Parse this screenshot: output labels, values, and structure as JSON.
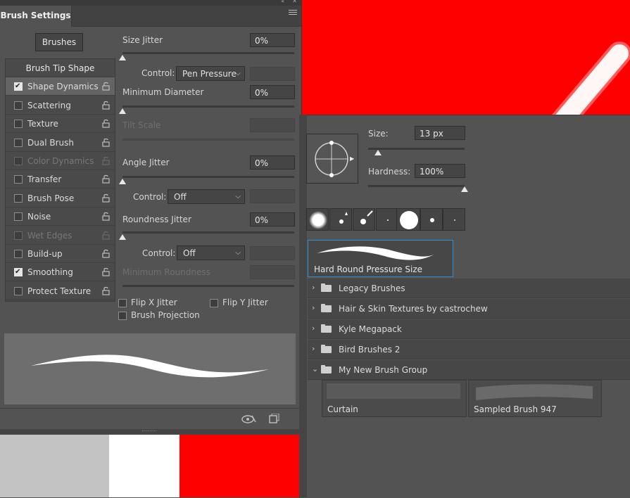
{
  "brush_settings": {
    "tab_title": "Brush Settings",
    "brushes_button": "Brushes",
    "options": [
      {
        "label": "Brush Tip Shape",
        "type": "header"
      },
      {
        "label": "Shape Dynamics",
        "checked": true,
        "selected": true
      },
      {
        "label": "Scattering",
        "checked": false
      },
      {
        "label": "Texture",
        "checked": false
      },
      {
        "label": "Dual Brush",
        "checked": false
      },
      {
        "label": "Color Dynamics",
        "checked": false,
        "disabled": true
      },
      {
        "label": "Transfer",
        "checked": false
      },
      {
        "label": "Brush Pose",
        "checked": false
      },
      {
        "label": "Noise",
        "checked": false
      },
      {
        "label": "Wet Edges",
        "checked": false,
        "disabled": true
      },
      {
        "label": "Build-up",
        "checked": false
      },
      {
        "label": "Smoothing",
        "checked": true
      },
      {
        "label": "Protect Texture",
        "checked": false
      }
    ],
    "size_jitter": {
      "label": "Size Jitter",
      "value": "0%",
      "level": 0
    },
    "size_control": {
      "label": "Control:",
      "value": "Pen Pressure"
    },
    "min_diameter": {
      "label": "Minimum Diameter",
      "value": "0%",
      "level": 0
    },
    "tilt_scale": {
      "label": "Tilt Scale"
    },
    "angle_jitter": {
      "label": "Angle Jitter",
      "value": "0%",
      "level": 0
    },
    "angle_control": {
      "label": "Control:",
      "value": "Off"
    },
    "roundness_jitter": {
      "label": "Roundness Jitter",
      "value": "0%",
      "level": 0
    },
    "roundness_control": {
      "label": "Control:",
      "value": "Off"
    },
    "min_roundness": {
      "label": "Minimum Roundness"
    },
    "flip_x": {
      "label": "Flip X Jitter",
      "checked": false
    },
    "flip_y": {
      "label": "Flip Y Jitter",
      "checked": false
    },
    "brush_projection": {
      "label": "Brush Projection",
      "checked": false
    }
  },
  "brush_picker": {
    "size_label": "Size:",
    "size_value": "13 px",
    "size_level": 0.05,
    "hardness_label": "Hardness:",
    "hardness_value": "100%",
    "hardness_level": 1.0,
    "selected_brush": "Hard Round Pressure Size",
    "groups": [
      {
        "name": "Legacy Brushes",
        "expanded": false
      },
      {
        "name": "Hair & Skin Textures by castrochew",
        "expanded": false
      },
      {
        "name": "Kyle Megapack",
        "expanded": false
      },
      {
        "name": "Bird Brushes 2",
        "expanded": false
      },
      {
        "name": "My New Brush Group",
        "expanded": true
      }
    ],
    "group_brushes": [
      "Curtain",
      "Sampled Brush 947"
    ]
  },
  "colors": {
    "canvas_red": "#ff0000",
    "accent_blue": "#2d8ed8"
  }
}
